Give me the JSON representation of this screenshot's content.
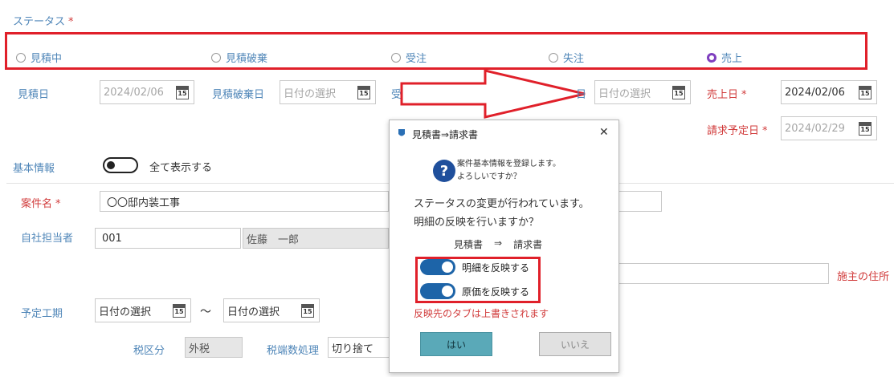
{
  "status": {
    "label": "ステータス",
    "required_mark": "*",
    "options": [
      {
        "label": "見積中",
        "selected": false
      },
      {
        "label": "見積破棄",
        "selected": false
      },
      {
        "label": "受注",
        "selected": false
      },
      {
        "label": "失注",
        "selected": false
      },
      {
        "label": "売上",
        "selected": true
      }
    ]
  },
  "dates": {
    "estimate_label": "見積日",
    "estimate_value": "2024/02/06",
    "discard_label": "見積破棄日",
    "discard_placeholder": "日付の選択",
    "partial_label": "受",
    "lost_label_suffix": "日",
    "lost_placeholder": "日付の選択",
    "sales_label": "売上日",
    "sales_value": "2024/02/06",
    "invoice_label": "請求予定日",
    "invoice_value": "2024/02/29",
    "calendar_day": "15"
  },
  "basic_info": {
    "label": "基本情報",
    "toggle_label": "全て表示する"
  },
  "project": {
    "name_label": "案件名",
    "name_value": "〇〇邸内装工事",
    "staff_label": "自社担当者",
    "staff_code": "001",
    "staff_name": "佐藤　一郎",
    "owner_address_label": "施主の住所"
  },
  "schedule": {
    "label": "予定工期",
    "start_placeholder": "日付の選択",
    "tilde": "～",
    "end_placeholder": "日付の選択"
  },
  "tax": {
    "class_label": "税区分",
    "class_value": "外税",
    "rounding_label": "税端数処理",
    "rounding_value": "切り捨て"
  },
  "dialog": {
    "title": "見積書⇒請求書",
    "close": "✕",
    "info_line1": "案件基本情報を登録します。",
    "info_line2": "よろしいですか？",
    "message1": "ステータスの変更が行われています。",
    "message2": "明細の反映を行いますか？",
    "from": "見積書",
    "arrow": "⇒",
    "to": "請求書",
    "toggle1": "明細を反映する",
    "toggle2": "原価を反映する",
    "warning": "反映先のタブは上書きされます",
    "yes": "はい",
    "no": "いいえ"
  },
  "colors": {
    "accent_blue": "#4f86b8",
    "required_red": "#d13b3b",
    "highlight_red": "#e0202a",
    "radio_selected": "#7f3fbf",
    "toggle_on": "#1d64a8",
    "yes_button": "#5aa9b8"
  }
}
